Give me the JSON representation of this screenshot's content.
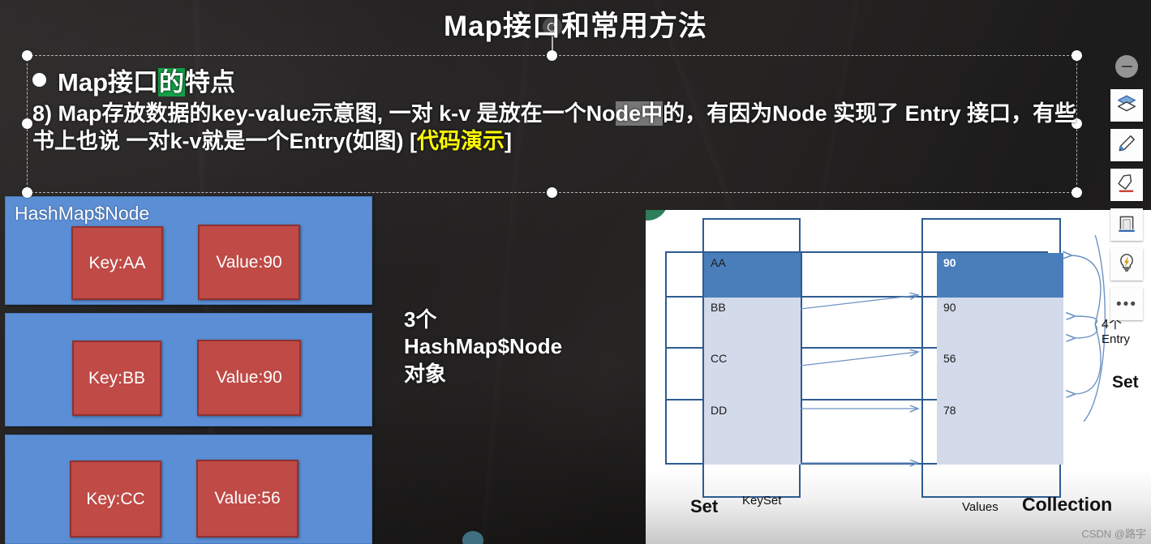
{
  "slide": {
    "title": "Map接口和常用方法",
    "bullet": {
      "prefix": "Map接口",
      "highlight_green": "的",
      "suffix": "特点"
    },
    "paragraph": {
      "seg1": "8) Map存放数据的key-value示意图, 一对 k-v 是放在一个No",
      "seg2_gray_highlight": "de中",
      "seg3": "的，有因为Node 实现了  Entry 接口，有些书上也说 一对k-v就是一个Entry(如图) [",
      "seg4_yellow_highlight": "代码演示",
      "seg5": "]"
    },
    "colors": {
      "node_blue": "#5b8ed4",
      "kv_red": "#bf4a46",
      "highlight_green": "#14a048",
      "highlight_yellow": "#fffb00",
      "table_border": "#2e5b91",
      "cell_dark": "#4a7ebb",
      "cell_light": "#d3daea"
    }
  },
  "left_diagram": {
    "node_label": "HashMap$Node",
    "nodes": [
      {
        "key": "Key:AA",
        "value": "Value:90"
      },
      {
        "key": "Key:BB",
        "value": "Value:90"
      },
      {
        "key": "Key:CC",
        "value": "Value:56"
      }
    ],
    "annotation": {
      "line1": "3个",
      "line2": "HashMap$Node",
      "line3": "对象"
    }
  },
  "right_diagram": {
    "rows": [
      {
        "key": "AA",
        "value": "90",
        "fill": "dark"
      },
      {
        "key": "BB",
        "value": "90",
        "fill": "light"
      },
      {
        "key": "CC",
        "value": "56",
        "fill": "light"
      },
      {
        "key": "DD",
        "value": "78",
        "fill": "light"
      }
    ],
    "labels": {
      "set_left": "Set",
      "keyset": "KeySet",
      "values": "Values",
      "collection": "Collection"
    },
    "entry_note": {
      "count": "4个",
      "label": "Entry"
    },
    "set_right": "Set"
  },
  "toolbar": {
    "collapse": "collapse",
    "items": [
      {
        "name": "layers",
        "label": "Layers"
      },
      {
        "name": "pen",
        "label": "Pen"
      },
      {
        "name": "eraser",
        "label": "Eraser"
      },
      {
        "name": "frame",
        "label": "Frame"
      },
      {
        "name": "lightbulb",
        "label": "Spotlight"
      },
      {
        "name": "more",
        "label": "…"
      }
    ],
    "more_glyph": "•••"
  },
  "watermark": "CSDN @路宇"
}
